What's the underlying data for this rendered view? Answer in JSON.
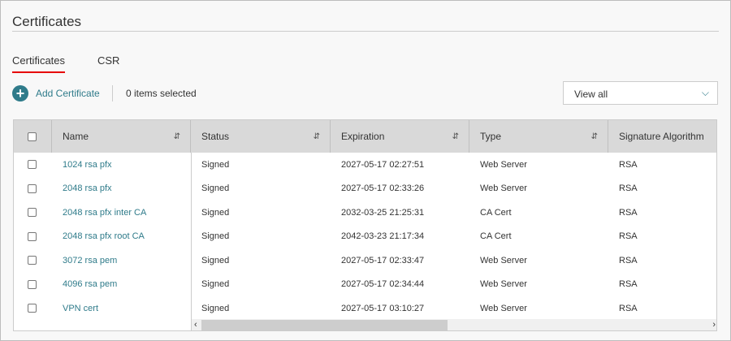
{
  "page": {
    "title": "Certificates"
  },
  "tabs": [
    {
      "label": "Certificates",
      "active": true
    },
    {
      "label": "CSR",
      "active": false
    }
  ],
  "toolbar": {
    "add_label": "Add Certificate",
    "selected_count": "0 items selected",
    "filter_value": "View all"
  },
  "table": {
    "columns": [
      "Name",
      "Status",
      "Expiration",
      "Type",
      "Signature Algorithm"
    ],
    "rows": [
      [
        "1024 rsa pfx",
        "Signed",
        "2027-05-17 02:27:51",
        "Web Server",
        "RSA"
      ],
      [
        "2048 rsa pfx",
        "Signed",
        "2027-05-17 02:33:26",
        "Web Server",
        "RSA"
      ],
      [
        "2048 rsa pfx inter CA",
        "Signed",
        "2032-03-25 21:25:31",
        "CA Cert",
        "RSA"
      ],
      [
        "2048 rsa pfx root CA",
        "Signed",
        "2042-03-23 21:17:34",
        "CA Cert",
        "RSA"
      ],
      [
        "3072 rsa pem",
        "Signed",
        "2027-05-17 02:33:47",
        "Web Server",
        "RSA"
      ],
      [
        "4096 rsa pem",
        "Signed",
        "2027-05-17 02:34:44",
        "Web Server",
        "RSA"
      ],
      [
        "VPN cert",
        "Signed",
        "2027-05-17 03:10:27",
        "Web Server",
        "RSA"
      ]
    ]
  },
  "colors": {
    "accent": "#2f7b8a",
    "tab_underline": "#e60000",
    "header_bg": "#d9d9d9"
  }
}
